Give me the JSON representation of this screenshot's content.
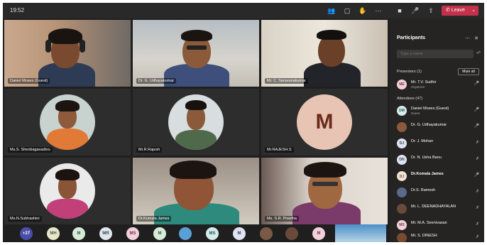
{
  "topbar": {
    "time": "19:52",
    "leave_label": "Leave"
  },
  "tiles": [
    {
      "name": "Daniel Moses (Guest)"
    },
    {
      "name": "Dr. G. Udhayakumar"
    },
    {
      "name": "Mr. C. Saravanakumar"
    },
    {
      "name": "Ms.S. Shenbagavadivu"
    },
    {
      "name": "Mr.R.Rajesh"
    },
    {
      "name": "Mr.RAJESH.S",
      "initial": "M"
    },
    {
      "name": "Ms.N.Subhashini"
    },
    {
      "name": "Dr.Komala James"
    },
    {
      "name": "Ms. S.R. Preetha"
    }
  ],
  "strip": {
    "overflow": "+27",
    "chips": [
      "MH",
      "M",
      "MR",
      "MS",
      "M",
      "MS",
      "M"
    ]
  },
  "panel": {
    "title": "Participants",
    "search_placeholder": "Type a name",
    "presenters_header": "Presenters (1)",
    "mute_all": "Mute all",
    "attendees_header": "Attendees (47)",
    "presenters": [
      {
        "initials": "ME",
        "name": "Mr. T.V. Sudhir",
        "sub": "Organizer"
      }
    ],
    "attendees": [
      {
        "initials": "DM",
        "name": "Daniel Moses (Guest)",
        "sub": "Guest"
      },
      {
        "initials": "",
        "name": "Dr. G. Udhayakumar",
        "sub": ""
      },
      {
        "initials": "DJ",
        "name": "Dr. J. Mohan",
        "sub": ""
      },
      {
        "initials": "DN",
        "name": "Dr. N. Usha Banu",
        "sub": ""
      },
      {
        "initials": "DJ",
        "name": "Dr.Komala James",
        "sub": ""
      },
      {
        "initials": "",
        "name": "Dr.S. Ramesh",
        "sub": ""
      },
      {
        "initials": "",
        "name": "Mr. L. DEENADHAYALAN",
        "sub": ""
      },
      {
        "initials": "MS",
        "name": "Mr. M.A. Seenivasan",
        "sub": ""
      },
      {
        "initials": "",
        "name": "Mr. S. DINESH",
        "sub": ""
      }
    ]
  },
  "colors": {
    "leave": "#c4314b",
    "panel_bg": "#252423",
    "m_avatar": "#e8c4b4"
  }
}
